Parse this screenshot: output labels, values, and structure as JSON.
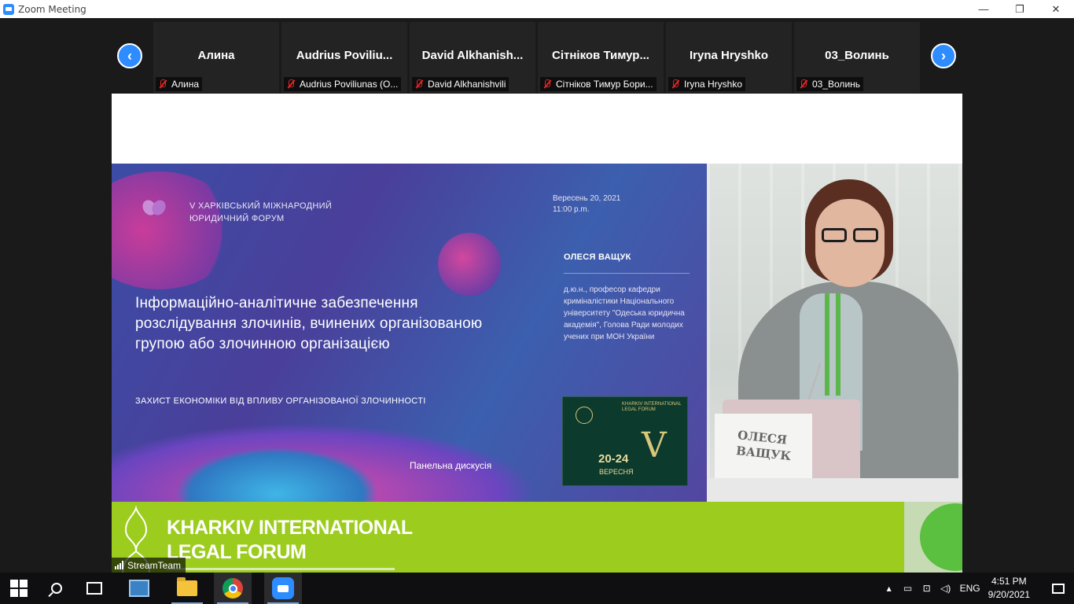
{
  "window": {
    "title": "Zoom Meeting",
    "controls": [
      "—",
      "❐",
      "✕"
    ]
  },
  "gallery": {
    "prev_icon": "chevron-left-icon",
    "next_icon": "chevron-right-icon",
    "tiles": [
      {
        "name": "Алина",
        "label": "Алина"
      },
      {
        "name": "Audrius  Poviliu...",
        "label": "Audrius Poviliunas (O..."
      },
      {
        "name": "David  Alkhanish...",
        "label": "David Alkhanishvili"
      },
      {
        "name": "Сітніков  Тимур...",
        "label": "Сітніков Тимур Бори..."
      },
      {
        "name": "Iryna Hryshko",
        "label": "Iryna Hryshko"
      },
      {
        "name": "03_Волинь",
        "label": "03_Волинь"
      }
    ]
  },
  "slide": {
    "forum_line1": "V ХАРКІВСЬКИЙ МІЖНАРОДНИЙ",
    "forum_line2": "ЮРИДИЧНИЙ ФОРУМ",
    "date_line1": "Вересень 20, 2021",
    "date_line2": "11:00 p.m.",
    "speaker_name": "ОЛЕСЯ ВАЩУК",
    "speaker_bio": "д.ю.н., професор кафедри криміналістики Національного університету \"Одеська юридична академія\", Голова Ради молодих учених при МОН України",
    "title": "Інформаційно-аналітичне забезпечення розслідування злочинів, вчинених організованою групою або злочинною організацією",
    "subtitle": "ЗАХИСТ ЕКОНОМІКИ ВІД ВПЛИВУ ОРГАНІЗОВАНОЇ ЗЛОЧИННОСТІ",
    "panel": "Панельна дискусія",
    "badge_small": "KHARKIV INTERNATIONAL LEGAL FORUM",
    "badge_v": "V",
    "badge_dates": "20-24",
    "badge_month": "ВЕРЕСНЯ"
  },
  "camera": {
    "nameplate": "ОЛЕСЯ ВАЩУК"
  },
  "banner": {
    "line1": "KHARKIV INTERNATIONAL",
    "line2": "LEGAL FORUM"
  },
  "video_label": "StreamTeam",
  "taskbar": {
    "lang": "ENG",
    "time": "4:51 PM",
    "date": "9/20/2021"
  },
  "colors": {
    "zoom_blue": "#2d8cff",
    "muted_red": "#e02828",
    "banner_green": "#9ccc1e"
  }
}
